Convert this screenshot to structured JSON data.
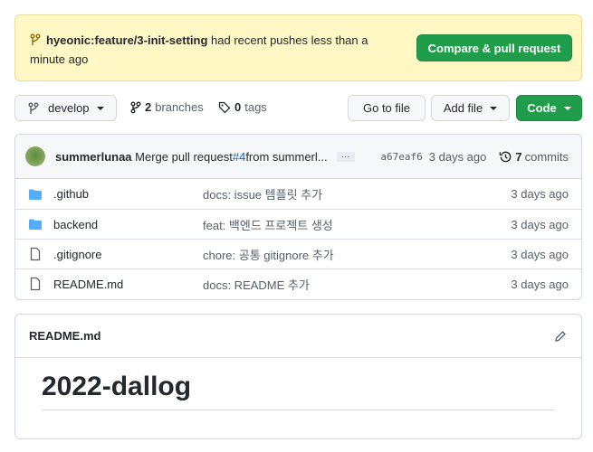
{
  "banner": {
    "branch": "hyeonic:feature/3-init-setting",
    "text": " had recent pushes less than a minute ago",
    "button": "Compare & pull request"
  },
  "toolbar": {
    "branch": "develop",
    "branches_count": "2",
    "branches_label": "branches",
    "tags_count": "0",
    "tags_label": "tags",
    "goto": "Go to file",
    "add": "Add file",
    "code": "Code"
  },
  "commit": {
    "author": "summerlunaa",
    "message_pre": "Merge pull request ",
    "pr": "#4",
    "message_post": " from summerl...",
    "sha": "a67eaf6",
    "age": "3 days ago",
    "commits_count": "7",
    "commits_label": "commits"
  },
  "files": [
    {
      "type": "folder",
      "name": ".github",
      "message": "docs: issue 템플릿 추가",
      "age": "3 days ago"
    },
    {
      "type": "folder",
      "name": "backend",
      "message": "feat: 백엔드 프로젝트 생성",
      "age": "3 days ago"
    },
    {
      "type": "file",
      "name": ".gitignore",
      "message": "chore: 공통 gitignore 추가",
      "age": "3 days ago"
    },
    {
      "type": "file",
      "name": "README.md",
      "message": "docs: README 추가",
      "age": "3 days ago"
    }
  ],
  "readme": {
    "filename": "README.md",
    "title": "2022-dallog"
  },
  "colors": {
    "accent_green": "#1f9d4a",
    "link": "#0969da",
    "folder": "#54aeff",
    "banner_bg": "#fff8c5"
  }
}
